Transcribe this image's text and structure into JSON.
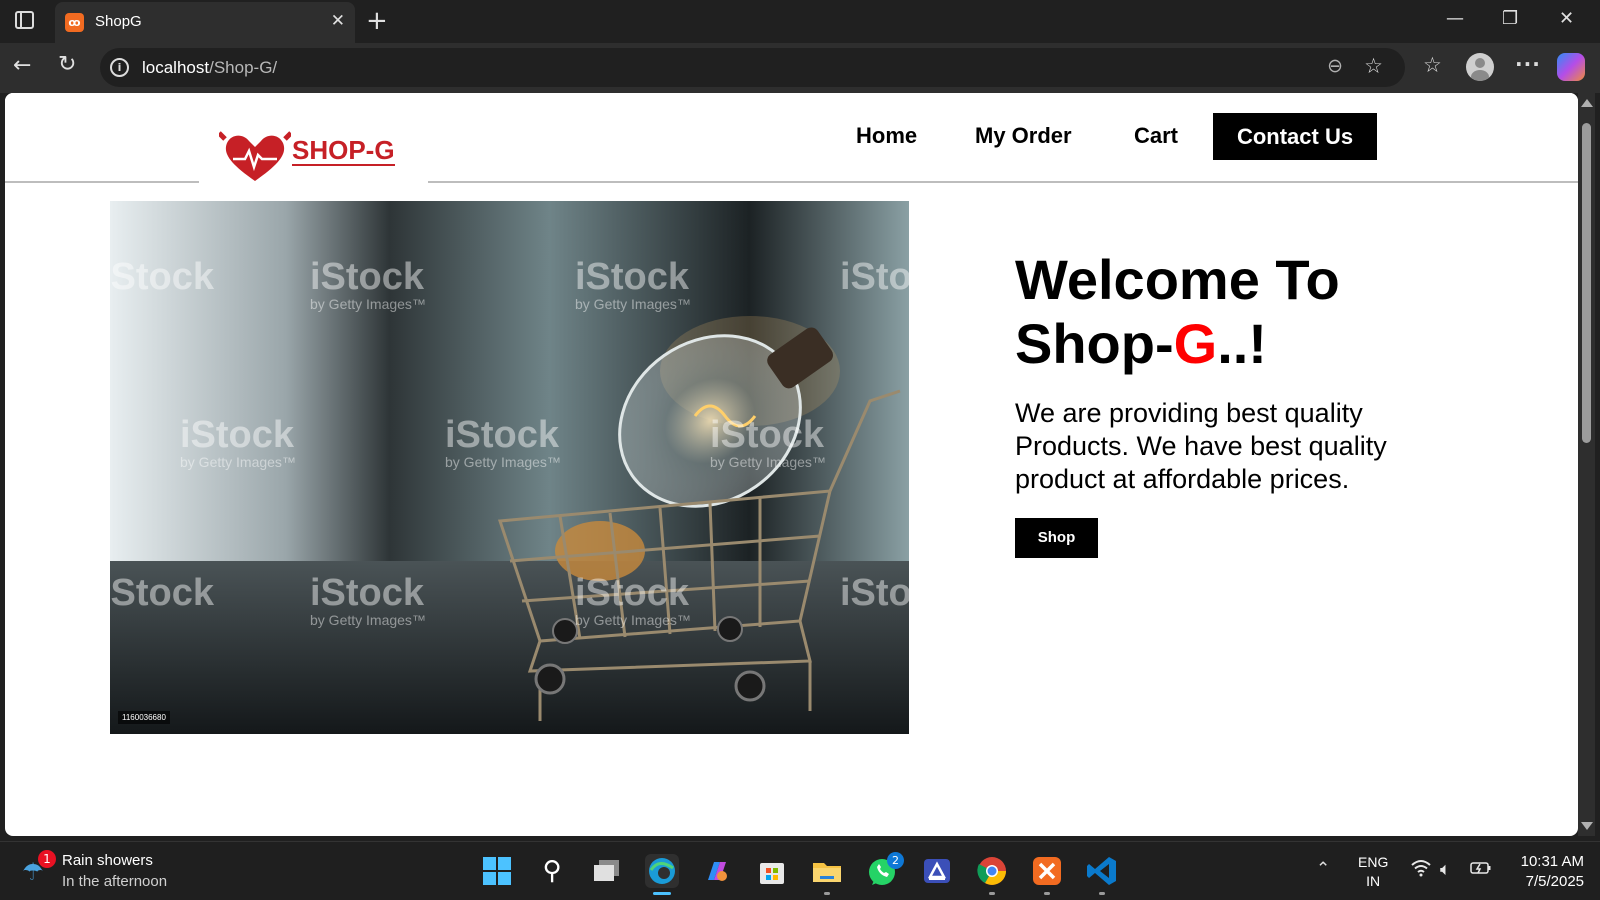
{
  "browser": {
    "tab_title": "ShopG",
    "url_host": "localhost",
    "url_path": "/Shop-G/"
  },
  "site": {
    "logo_text": "SHOP-G",
    "nav": {
      "home": "Home",
      "my_order": "My Order",
      "cart": "Cart",
      "contact": "Contact Us"
    },
    "hero": {
      "image_id": "1160036680",
      "watermark": "iStock",
      "watermark_sub": "by Getty Images™",
      "title_part1": "Welcome To Shop-",
      "title_accent": "G",
      "title_part2": "..!",
      "description": "We are providing best quality Products. We have best quality product at affordable prices.",
      "shop_button": "Shop"
    }
  },
  "taskbar": {
    "weather_title": "Rain showers",
    "weather_sub": "In the afternoon",
    "weather_badge": "1",
    "whatsapp_badge": "2",
    "lang_line1": "ENG",
    "lang_line2": "IN",
    "time": "10:31 AM",
    "date": "7/5/2025"
  },
  "colors": {
    "accent_red": "#ff0000",
    "logo_red": "#c62026",
    "nav_button_bg": "#000000"
  }
}
